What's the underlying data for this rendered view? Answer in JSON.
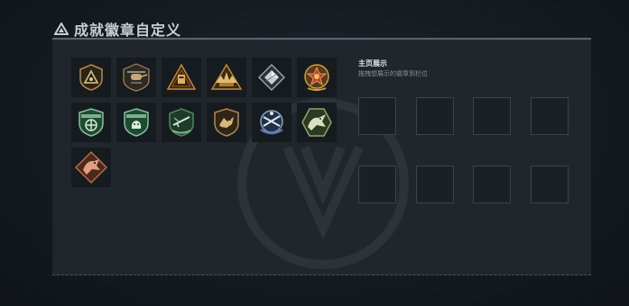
{
  "header": {
    "title": "成就徽章自定义",
    "icon": "warning-triangle-icon"
  },
  "showcase": {
    "title": "主页展示",
    "hint": "拖拽想展示的徽章到栏位",
    "slot_count": 8
  },
  "badges": [
    {
      "icon": "triangle-shield-badge-icon",
      "color": "#b78a4a"
    },
    {
      "icon": "helicopter-badge-icon",
      "color": "#a8875a"
    },
    {
      "icon": "triangle-card-badge-icon",
      "color": "#c08a3e"
    },
    {
      "icon": "triangle-eagle-badge-icon",
      "color": "#b88a3a"
    },
    {
      "icon": "diamond-badge-icon",
      "color": "#9aa3aa"
    },
    {
      "icon": "star-emblem-badge-icon",
      "color": "#b8403a"
    },
    {
      "icon": "green-shield-cross-badge-icon",
      "color": "#4f9a6a"
    },
    {
      "icon": "green-shield-lion-badge-icon",
      "color": "#5aa27a"
    },
    {
      "icon": "green-rifle-badge-icon",
      "color": "#4a8a5a"
    },
    {
      "icon": "gold-wolf-shield-badge-icon",
      "color": "#b08a4a"
    },
    {
      "icon": "blue-rifles-badge-icon",
      "color": "#5a78b0"
    },
    {
      "icon": "green-dragon-hex-badge-icon",
      "color": "#6a9a5a"
    },
    {
      "icon": "copper-dragon-diamond-badge-icon",
      "color": "#b86a4a"
    }
  ]
}
